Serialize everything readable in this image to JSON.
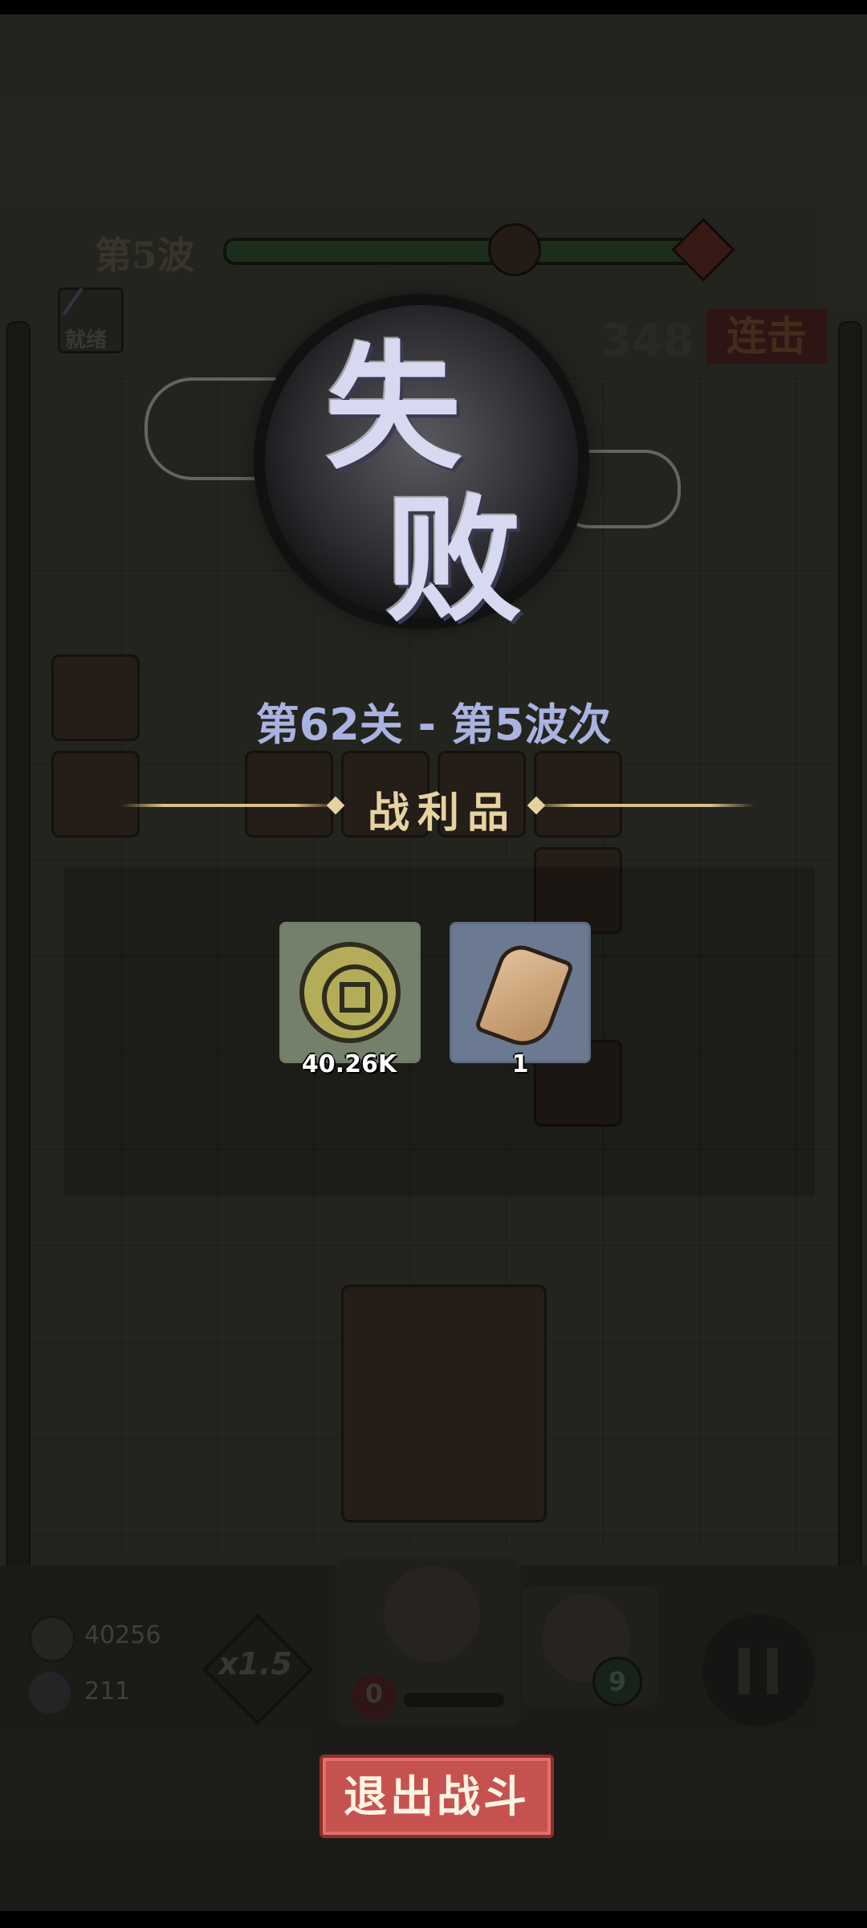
{
  "hud": {
    "wave_label": "第5波",
    "skill_status": "就绪",
    "combo_count": "348",
    "combo_label": "连击"
  },
  "result": {
    "title_char_1": "失",
    "title_char_2": "败",
    "level_info": "第62关 - 第5波次",
    "loot_title": "战利品",
    "loot": [
      {
        "name": "coin-icon",
        "amount": "40.26K"
      },
      {
        "name": "stone-icon",
        "amount": "1"
      }
    ]
  },
  "bottom": {
    "coins": "40256",
    "kills": "211",
    "speed": "x1.5",
    "hero_hp": "0",
    "hero2_level": "9",
    "exit_button": "退出战斗"
  },
  "colors": {
    "exit_button": "#c6524f",
    "level_text": "#aab2e0",
    "loot_title": "#e6d3a0"
  }
}
